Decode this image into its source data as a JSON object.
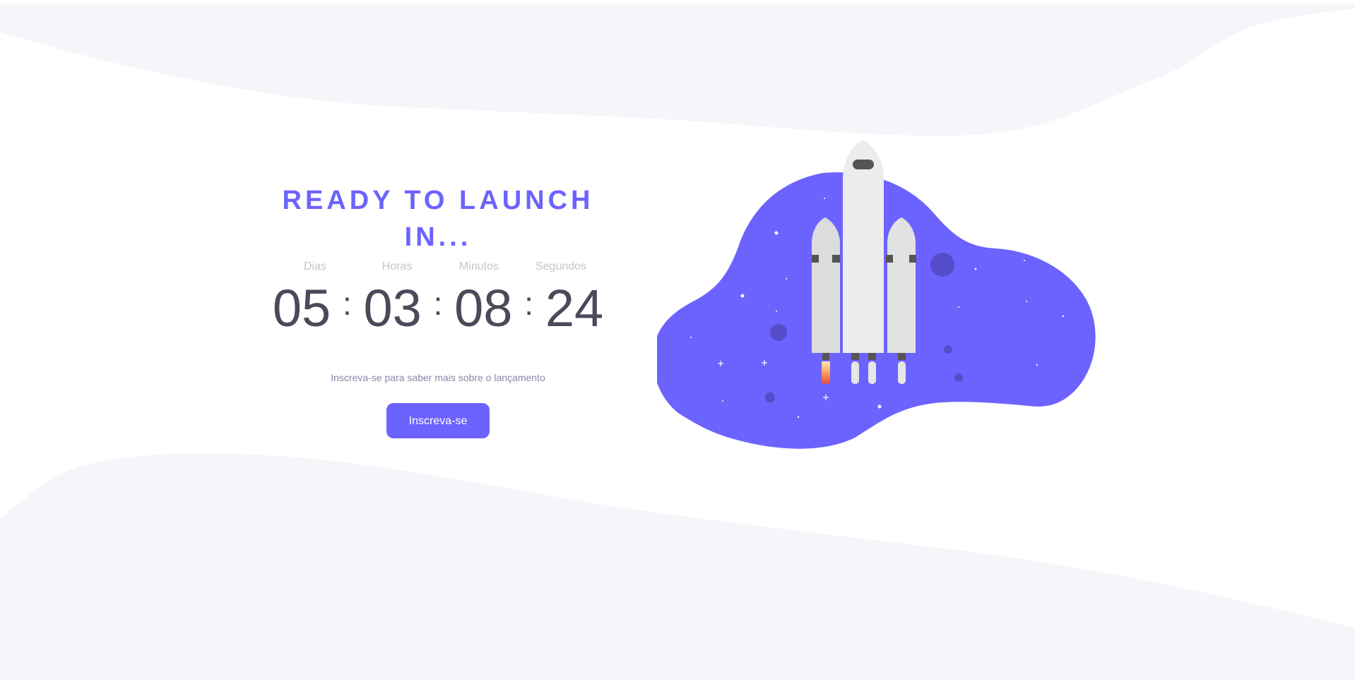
{
  "headline": "READY TO LAUNCH IN...",
  "countdown": {
    "labels": [
      "Dias",
      "Horas",
      "Minutos",
      "Segundos"
    ],
    "values": [
      "05",
      "03",
      "08",
      "24"
    ],
    "separator": ":"
  },
  "subscribe": {
    "text": "Inscreva-se para saber mais sobre o lançamento",
    "button_label": "Inscreva-se"
  },
  "colors": {
    "accent": "#6c63ff",
    "digits": "#4a4a5a",
    "labels": "#c4c4cc",
    "wave": "#f5f5fa"
  },
  "illustration": {
    "subject": "rocket-launch-illustration"
  }
}
